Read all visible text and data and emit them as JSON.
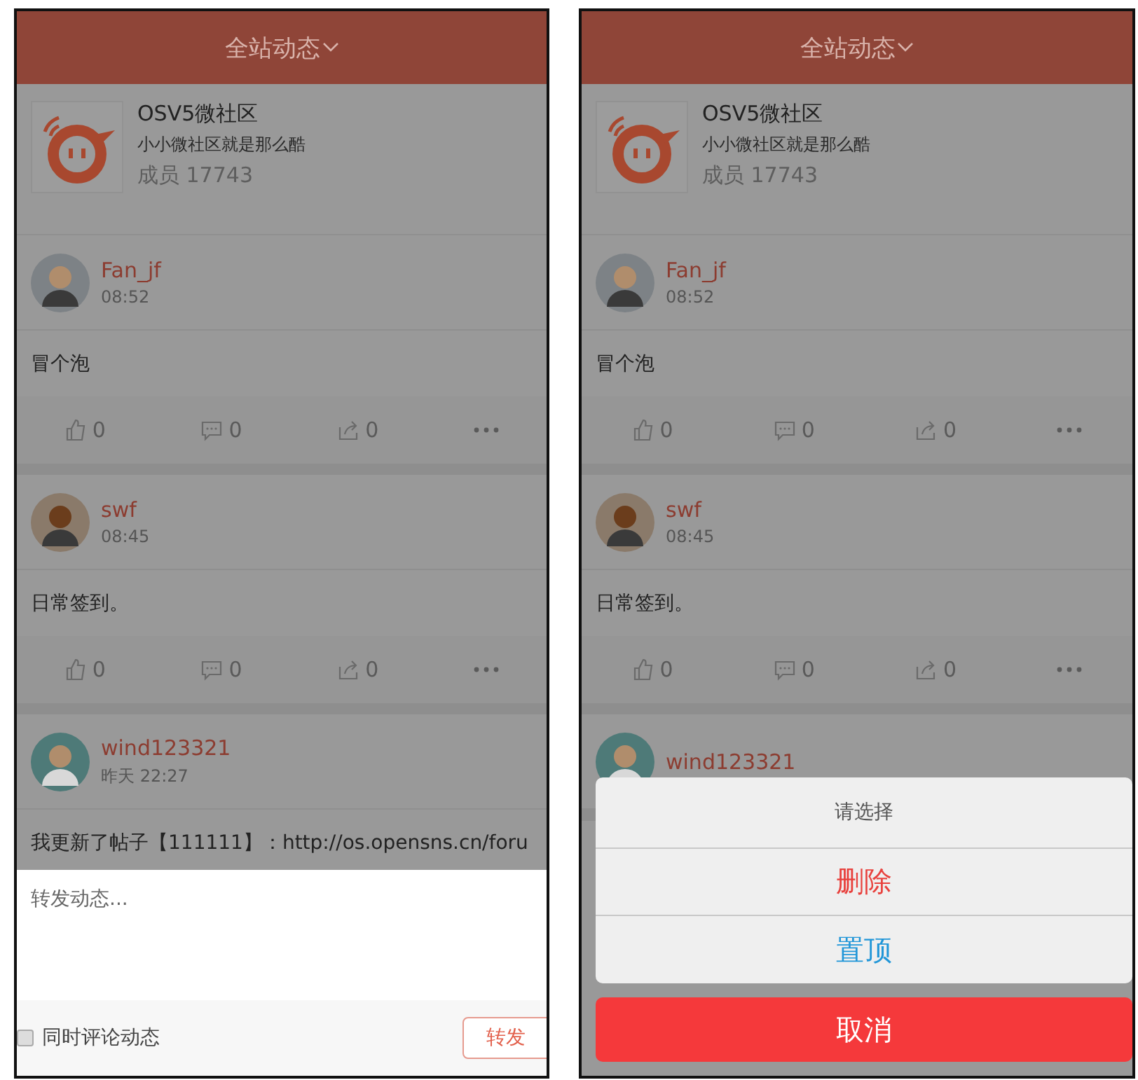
{
  "screens": [
    {
      "header": {
        "title": "全站动态"
      },
      "group": {
        "name": "OSV5微社区",
        "slogan": "小小微社区就是那么酷",
        "members": "成员 17743"
      },
      "posts": [
        {
          "author": "Fan_jf",
          "time": "08:52",
          "text": "冒个泡",
          "likes": "0",
          "comments": "0",
          "shares": "0"
        },
        {
          "author": "swf",
          "time": "08:45",
          "text": "日常签到。",
          "likes": "0",
          "comments": "0",
          "shares": "0"
        },
        {
          "author": "wind123321",
          "time": "昨天 22:27",
          "text": "我更新了帖子【111111】：http://os.opensns.cn/foru"
        }
      ],
      "overlay": {
        "kind": "repost",
        "placeholder": "转发动态...",
        "also_comment": {
          "label": "同时评论动态",
          "checked": false
        },
        "submit": "转发"
      }
    },
    {
      "header": {
        "title": "全站动态"
      },
      "group": {
        "name": "OSV5微社区",
        "slogan": "小小微社区就是那么酷",
        "members": "成员 17743"
      },
      "posts": [
        {
          "author": "Fan_jf",
          "time": "08:52",
          "text": "冒个泡",
          "likes": "0",
          "comments": "0",
          "shares": "0"
        },
        {
          "author": "swf",
          "time": "08:45",
          "text": "日常签到。",
          "likes": "0",
          "comments": "0",
          "shares": "0"
        },
        {
          "author": "wind123321"
        }
      ],
      "overlay": {
        "kind": "action_sheet",
        "title": "请选择",
        "options": [
          {
            "label": "删除",
            "color": "#e8413d"
          },
          {
            "label": "置顶",
            "color": "#2196d8"
          }
        ],
        "cancel": "取消"
      }
    }
  ]
}
